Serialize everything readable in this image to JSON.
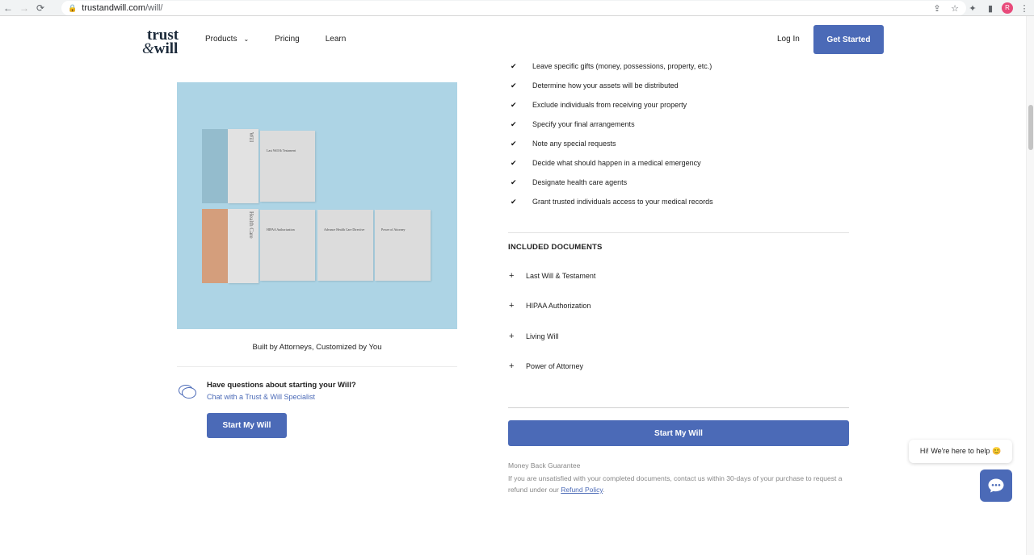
{
  "browser": {
    "url_domain": "trustandwill.com",
    "url_path": "/will/",
    "avatar_initial": "R"
  },
  "header": {
    "logo_line1": "trust",
    "logo_amp": "&",
    "logo_line2": "will",
    "nav": [
      {
        "label": "Products"
      },
      {
        "label": "Pricing"
      },
      {
        "label": "Learn"
      }
    ],
    "login_label": "Log In",
    "get_started_label": "Get Started"
  },
  "hero": {
    "spine_top": "Will",
    "spine_bottom": "Health Care",
    "doc_will": "Last Will & Testament",
    "doc_hipaa": "HIPAA Authorization",
    "doc_advance": "Advance Health Care Directive",
    "doc_poa": "Power of Attorney",
    "caption": "Built by Attorneys, Customized by You"
  },
  "questions": {
    "title": "Have questions about starting your Will?",
    "link": "Chat with a Trust & Will Specialist",
    "button": "Start My Will"
  },
  "features": [
    "Leave specific gifts (money, possessions, property, etc.)",
    "Determine how your assets will be distributed",
    "Exclude individuals from receiving your property",
    "Specify your final arrangements",
    "Note any special requests",
    "Decide what should happen in a medical emergency",
    "Designate health care agents",
    "Grant trusted individuals access to your medical records"
  ],
  "included": {
    "title": "INCLUDED DOCUMENTS",
    "docs": [
      "Last Will & Testament",
      "HIPAA Authorization",
      "Living Will",
      "Power of Attorney"
    ],
    "button": "Start My Will"
  },
  "guarantee": {
    "title": "Money Back Guarantee",
    "text": "If you are unsatisfied with your completed documents, contact us within 30-days of your purchase to request a refund under our ",
    "link": "Refund Policy",
    "end": "."
  },
  "chat_widget": {
    "bubble": "Hi! We're here to help 😊"
  },
  "colors": {
    "brand_blue": "#4b6ab7",
    "hero_bg": "#add4e5",
    "spine_blue": "#94bccd",
    "spine_orange": "#d49e7c"
  }
}
